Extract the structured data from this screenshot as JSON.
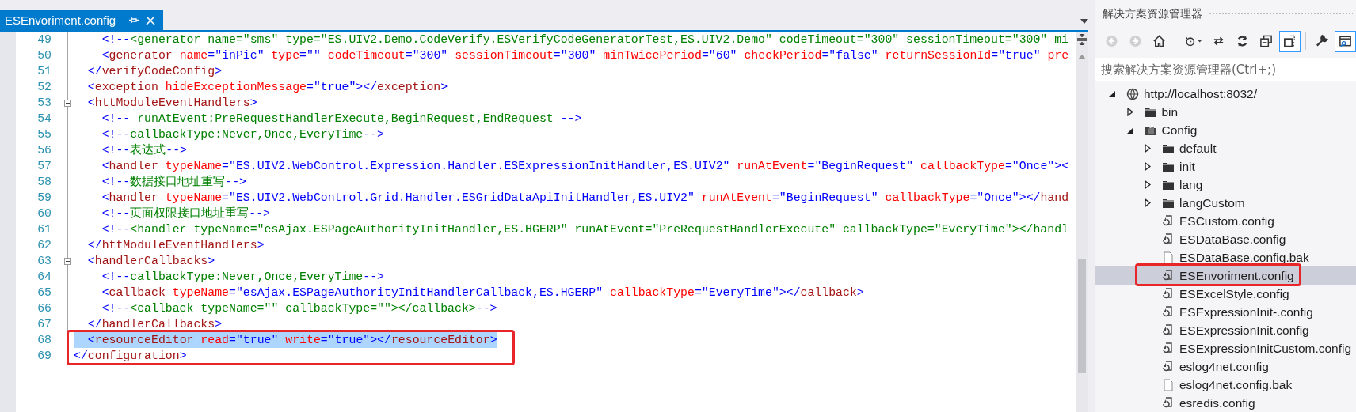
{
  "tab": {
    "label": "ESEnvoriment.config",
    "selected": true
  },
  "editor": {
    "lines": [
      {
        "number": "49",
        "fold_start": false,
        "selected": false,
        "boxed": false,
        "segments": [
          {
            "kind": "delim",
            "text": "    <!--"
          },
          {
            "kind": "comment",
            "text": "<generator name=\"sms\" type=\"ES.UIV2.Demo.CodeVerify.ESVerifyCodeGeneratorTest,ES.UIV2.Demo\" codeTimeout=\"300\" sessionTimeout=\"300\" mi"
          }
        ]
      },
      {
        "number": "50",
        "fold_start": false,
        "selected": false,
        "boxed": false,
        "segments": [
          {
            "kind": "delim",
            "text": "    <"
          },
          {
            "kind": "tag",
            "text": "generator"
          },
          {
            "kind": "attr",
            "text": " name"
          },
          {
            "kind": "delim",
            "text": "="
          },
          {
            "kind": "value",
            "text": "\"inPic\""
          },
          {
            "kind": "attr",
            "text": " type"
          },
          {
            "kind": "delim",
            "text": "="
          },
          {
            "kind": "value",
            "text": "\"\""
          },
          {
            "kind": "attr",
            "text": " codeTimeout"
          },
          {
            "kind": "delim",
            "text": "="
          },
          {
            "kind": "value",
            "text": "\"300\""
          },
          {
            "kind": "attr",
            "text": " sessionTimeout"
          },
          {
            "kind": "delim",
            "text": "="
          },
          {
            "kind": "value",
            "text": "\"300\""
          },
          {
            "kind": "attr",
            "text": " minTwicePeriod"
          },
          {
            "kind": "delim",
            "text": "="
          },
          {
            "kind": "value",
            "text": "\"60\""
          },
          {
            "kind": "attr",
            "text": " checkPeriod"
          },
          {
            "kind": "delim",
            "text": "="
          },
          {
            "kind": "value",
            "text": "\"false\""
          },
          {
            "kind": "attr",
            "text": " returnSessionId"
          },
          {
            "kind": "delim",
            "text": "="
          },
          {
            "kind": "value",
            "text": "\"true\""
          },
          {
            "kind": "attr",
            "text": " pre"
          }
        ]
      },
      {
        "number": "51",
        "fold_start": false,
        "selected": false,
        "boxed": false,
        "segments": [
          {
            "kind": "delim",
            "text": "  </"
          },
          {
            "kind": "tag",
            "text": "verifyCodeConfig"
          },
          {
            "kind": "delim",
            "text": ">"
          }
        ]
      },
      {
        "number": "52",
        "fold_start": false,
        "selected": false,
        "boxed": false,
        "segments": [
          {
            "kind": "delim",
            "text": "  <"
          },
          {
            "kind": "tag",
            "text": "exception"
          },
          {
            "kind": "attr",
            "text": " hideExceptionMessage"
          },
          {
            "kind": "delim",
            "text": "="
          },
          {
            "kind": "value",
            "text": "\"true\""
          },
          {
            "kind": "delim",
            "text": "></"
          },
          {
            "kind": "tag",
            "text": "exception"
          },
          {
            "kind": "delim",
            "text": ">"
          }
        ]
      },
      {
        "number": "53",
        "fold_start": true,
        "selected": false,
        "boxed": false,
        "segments": [
          {
            "kind": "delim",
            "text": "  <"
          },
          {
            "kind": "tag",
            "text": "httModuleEventHandlers"
          },
          {
            "kind": "delim",
            "text": ">"
          }
        ]
      },
      {
        "number": "54",
        "fold_start": false,
        "selected": false,
        "boxed": false,
        "segments": [
          {
            "kind": "delim",
            "text": "    <!--"
          },
          {
            "kind": "comment",
            "text": " runAtEvent:PreRequestHandlerExecute,BeginRequest,EndRequest "
          },
          {
            "kind": "delim",
            "text": "-->"
          }
        ]
      },
      {
        "number": "55",
        "fold_start": false,
        "selected": false,
        "boxed": false,
        "segments": [
          {
            "kind": "delim",
            "text": "    <!--"
          },
          {
            "kind": "comment",
            "text": "callbackType:Never,Once,EveryTime"
          },
          {
            "kind": "delim",
            "text": "-->"
          }
        ]
      },
      {
        "number": "56",
        "fold_start": false,
        "selected": false,
        "boxed": false,
        "segments": [
          {
            "kind": "delim",
            "text": "    <!--"
          },
          {
            "kind": "comment",
            "text": "表达式"
          },
          {
            "kind": "delim",
            "text": "-->"
          }
        ]
      },
      {
        "number": "57",
        "fold_start": false,
        "selected": false,
        "boxed": false,
        "segments": [
          {
            "kind": "delim",
            "text": "    <"
          },
          {
            "kind": "tag",
            "text": "handler"
          },
          {
            "kind": "attr",
            "text": " typeName"
          },
          {
            "kind": "delim",
            "text": "="
          },
          {
            "kind": "value",
            "text": "\"ES.UIV2.WebControl.Expression.Handler.ESExpressionInitHandler,ES.UIV2\""
          },
          {
            "kind": "attr",
            "text": " runAtEvent"
          },
          {
            "kind": "delim",
            "text": "="
          },
          {
            "kind": "value",
            "text": "\"BeginRequest\""
          },
          {
            "kind": "attr",
            "text": " callbackType"
          },
          {
            "kind": "delim",
            "text": "="
          },
          {
            "kind": "value",
            "text": "\"Once\""
          },
          {
            "kind": "delim",
            "text": "><"
          }
        ]
      },
      {
        "number": "58",
        "fold_start": false,
        "selected": false,
        "boxed": false,
        "segments": [
          {
            "kind": "delim",
            "text": "    <!--"
          },
          {
            "kind": "comment",
            "text": "数据接口地址重写"
          },
          {
            "kind": "delim",
            "text": "-->"
          }
        ]
      },
      {
        "number": "59",
        "fold_start": false,
        "selected": false,
        "boxed": false,
        "segments": [
          {
            "kind": "delim",
            "text": "    <"
          },
          {
            "kind": "tag",
            "text": "handler"
          },
          {
            "kind": "attr",
            "text": " typeName"
          },
          {
            "kind": "delim",
            "text": "="
          },
          {
            "kind": "value",
            "text": "\"ES.UIV2.WebControl.Grid.Handler.ESGridDataApiInitHandler,ES.UIV2\""
          },
          {
            "kind": "attr",
            "text": " runAtEvent"
          },
          {
            "kind": "delim",
            "text": "="
          },
          {
            "kind": "value",
            "text": "\"BeginRequest\""
          },
          {
            "kind": "attr",
            "text": " callbackType"
          },
          {
            "kind": "delim",
            "text": "="
          },
          {
            "kind": "value",
            "text": "\"Once\""
          },
          {
            "kind": "delim",
            "text": "></"
          },
          {
            "kind": "tag",
            "text": "hand"
          }
        ]
      },
      {
        "number": "60",
        "fold_start": false,
        "selected": false,
        "boxed": false,
        "segments": [
          {
            "kind": "delim",
            "text": "    <!--"
          },
          {
            "kind": "comment",
            "text": "页面权限接口地址重写"
          },
          {
            "kind": "delim",
            "text": "-->"
          }
        ]
      },
      {
        "number": "61",
        "fold_start": false,
        "selected": false,
        "boxed": false,
        "segments": [
          {
            "kind": "delim",
            "text": "    <!--"
          },
          {
            "kind": "comment",
            "text": "<handler typeName=\"esAjax.ESPageAuthorityInitHandler,ES.HGERP\" runAtEvent=\"PreRequestHandlerExecute\" callbackType=\"EveryTime\"></handl"
          }
        ]
      },
      {
        "number": "62",
        "fold_start": false,
        "selected": false,
        "boxed": false,
        "segments": [
          {
            "kind": "delim",
            "text": "  </"
          },
          {
            "kind": "tag",
            "text": "httModuleEventHandlers"
          },
          {
            "kind": "delim",
            "text": ">"
          }
        ]
      },
      {
        "number": "63",
        "fold_start": true,
        "selected": false,
        "boxed": false,
        "segments": [
          {
            "kind": "delim",
            "text": "  <"
          },
          {
            "kind": "tag",
            "text": "handlerCallbacks"
          },
          {
            "kind": "delim",
            "text": ">"
          }
        ]
      },
      {
        "number": "64",
        "fold_start": false,
        "selected": false,
        "boxed": false,
        "segments": [
          {
            "kind": "delim",
            "text": "    <!--"
          },
          {
            "kind": "comment",
            "text": "callbackType:Never,Once,EveryTime"
          },
          {
            "kind": "delim",
            "text": "-->"
          }
        ]
      },
      {
        "number": "65",
        "fold_start": false,
        "selected": false,
        "boxed": false,
        "segments": [
          {
            "kind": "delim",
            "text": "    <"
          },
          {
            "kind": "tag",
            "text": "callback"
          },
          {
            "kind": "attr",
            "text": " typeName"
          },
          {
            "kind": "delim",
            "text": "="
          },
          {
            "kind": "value",
            "text": "\"esAjax.ESPageAuthorityInitHandlerCallback,ES.HGERP\""
          },
          {
            "kind": "attr",
            "text": " callbackType"
          },
          {
            "kind": "delim",
            "text": "="
          },
          {
            "kind": "value",
            "text": "\"EveryTime\""
          },
          {
            "kind": "delim",
            "text": "></"
          },
          {
            "kind": "tag",
            "text": "callback"
          },
          {
            "kind": "delim",
            "text": ">"
          }
        ]
      },
      {
        "number": "66",
        "fold_start": false,
        "selected": false,
        "boxed": false,
        "segments": [
          {
            "kind": "delim",
            "text": "    <!--"
          },
          {
            "kind": "comment",
            "text": "<callback typeName=\"\" callbackType=\"\"></callback>"
          },
          {
            "kind": "delim",
            "text": "-->"
          }
        ]
      },
      {
        "number": "67",
        "fold_start": false,
        "selected": false,
        "boxed": false,
        "segments": [
          {
            "kind": "delim",
            "text": "  </"
          },
          {
            "kind": "tag",
            "text": "handlerCallbacks"
          },
          {
            "kind": "delim",
            "text": ">"
          }
        ]
      },
      {
        "number": "68",
        "fold_start": false,
        "selected": true,
        "boxed": true,
        "segments": [
          {
            "kind": "delim",
            "text": "  <"
          },
          {
            "kind": "tag",
            "text": "resourceEditor"
          },
          {
            "kind": "attr",
            "text": " read"
          },
          {
            "kind": "delim",
            "text": "="
          },
          {
            "kind": "value",
            "text": "\"true\""
          },
          {
            "kind": "attr",
            "text": " write"
          },
          {
            "kind": "delim",
            "text": "="
          },
          {
            "kind": "value",
            "text": "\"true\""
          },
          {
            "kind": "delim",
            "text": "></"
          },
          {
            "kind": "tag",
            "text": "resourceEditor"
          },
          {
            "kind": "delim",
            "text": ">"
          }
        ]
      },
      {
        "number": "69",
        "fold_start": false,
        "selected": false,
        "boxed": true,
        "segments": [
          {
            "kind": "delim",
            "text": "</"
          },
          {
            "kind": "tag",
            "text": "configuration"
          },
          {
            "kind": "delim",
            "text": ">"
          }
        ]
      }
    ]
  },
  "explorer": {
    "title": "解决方案资源管理器",
    "toolbar_groups": [
      [
        {
          "kind": "back",
          "disabled": true,
          "pressed": false
        },
        {
          "kind": "forward",
          "disabled": true,
          "pressed": false
        },
        {
          "kind": "home",
          "disabled": false,
          "pressed": false
        }
      ],
      [
        {
          "kind": "history",
          "disabled": false,
          "pressed": false
        },
        {
          "kind": "sync",
          "disabled": false,
          "pressed": false
        },
        {
          "kind": "refresh",
          "disabled": false,
          "pressed": false
        },
        {
          "kind": "collapse",
          "disabled": false,
          "pressed": false
        },
        {
          "kind": "show_all",
          "disabled": false,
          "pressed": true
        }
      ],
      [
        {
          "kind": "properties",
          "disabled": false,
          "pressed": false
        },
        {
          "kind": "preview",
          "disabled": false,
          "pressed": true
        }
      ]
    ],
    "search": {
      "placeholder": "搜索解决方案资源管理器(Ctrl+;)"
    },
    "tree": [
      {
        "label": "http://localhost:8032/",
        "kind": "site",
        "expanded": true,
        "selected": false,
        "boxed": false,
        "children": [
          {
            "label": "bin",
            "kind": "folder",
            "expanded": false,
            "selected": false,
            "boxed": false
          },
          {
            "label": "Config",
            "kind": "folder",
            "expanded": true,
            "selected": false,
            "boxed": false,
            "children": [
              {
                "label": "default",
                "kind": "folder",
                "expanded": false,
                "selected": false,
                "boxed": false
              },
              {
                "label": "init",
                "kind": "folder",
                "expanded": false,
                "selected": false,
                "boxed": false
              },
              {
                "label": "lang",
                "kind": "folder",
                "expanded": false,
                "selected": false,
                "boxed": false
              },
              {
                "label": "langCustom",
                "kind": "folder",
                "expanded": false,
                "selected": false,
                "boxed": false
              },
              {
                "label": "ESCustom.config",
                "kind": "config",
                "selected": false,
                "boxed": false
              },
              {
                "label": "ESDataBase.config",
                "kind": "config",
                "selected": false,
                "boxed": false
              },
              {
                "label": "ESDataBase.config.bak",
                "kind": "file",
                "selected": false,
                "boxed": false
              },
              {
                "label": "ESEnvoriment.config",
                "kind": "config",
                "selected": true,
                "boxed": true
              },
              {
                "label": "ESExcelStyle.config",
                "kind": "config",
                "selected": false,
                "boxed": false
              },
              {
                "label": "ESExpressionInit-.config",
                "kind": "config",
                "selected": false,
                "boxed": false
              },
              {
                "label": "ESExpressionInit.config",
                "kind": "config",
                "selected": false,
                "boxed": false
              },
              {
                "label": "ESExpressionInitCustom.config",
                "kind": "config",
                "selected": false,
                "boxed": false
              },
              {
                "label": "eslog4net.config",
                "kind": "config",
                "selected": false,
                "boxed": false
              },
              {
                "label": "eslog4net.config.bak",
                "kind": "file",
                "selected": false,
                "boxed": false
              },
              {
                "label": "esredis.config",
                "kind": "config",
                "selected": false,
                "boxed": false
              }
            ]
          }
        ]
      }
    ]
  }
}
